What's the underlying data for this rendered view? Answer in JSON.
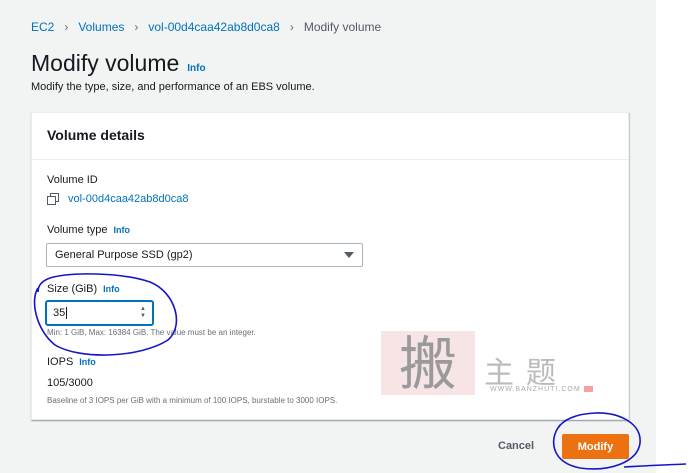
{
  "breadcrumb": {
    "items": [
      "EC2",
      "Volumes",
      "vol-00d4caa42ab8d0ca8"
    ],
    "current": "Modify volume"
  },
  "header": {
    "title": "Modify volume",
    "info": "Info",
    "subtitle": "Modify the type, size, and performance of an EBS volume."
  },
  "panel": {
    "title": "Volume details",
    "volume_id": {
      "label": "Volume ID",
      "value": "vol-00d4caa42ab8d0ca8"
    },
    "volume_type": {
      "label": "Volume type",
      "info": "Info",
      "selected": "General Purpose SSD (gp2)"
    },
    "size": {
      "label": "Size (GiB)",
      "info": "Info",
      "value": "35",
      "constraint": "Min: 1 GiB, Max: 16384 GiB. The value must be an integer."
    },
    "iops": {
      "label": "IOPS",
      "info": "Info",
      "value": "105/3000",
      "description": "Baseline of 3 IOPS per GiB with a minimum of 100 IOPS, burstable to 3000 IOPS."
    }
  },
  "actions": {
    "cancel": "Cancel",
    "modify": "Modify"
  },
  "watermark": {
    "chars": "主题",
    "seal_char": "搬",
    "url": "WWW.BANZHUTI.COM"
  },
  "colors": {
    "link": "#0073bb",
    "primary_button": "#ec7211",
    "annotation": "#1515c8"
  }
}
